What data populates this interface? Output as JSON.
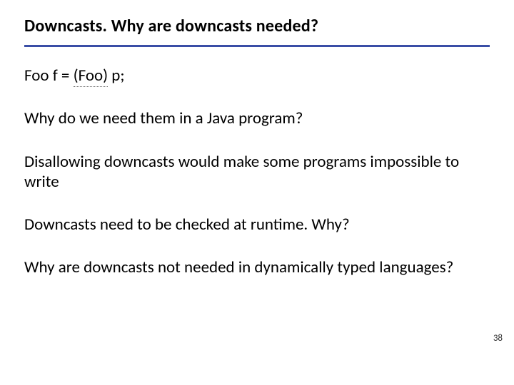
{
  "slide": {
    "title_prefix": "Downcasts.",
    "title_rest": "  Why are downcasts needed?",
    "code_line": {
      "pre": "Foo f = ",
      "cast": "(Foo)",
      "post": " p;"
    },
    "para1": "Why do we need them in a Java program?",
    "para2": "Disallowing downcasts would make some programs impossible to write",
    "para3": "Downcasts need to be checked at runtime.  Why?",
    "para4": "Why are downcasts not needed in dynamically typed languages?",
    "page_number": "38"
  }
}
